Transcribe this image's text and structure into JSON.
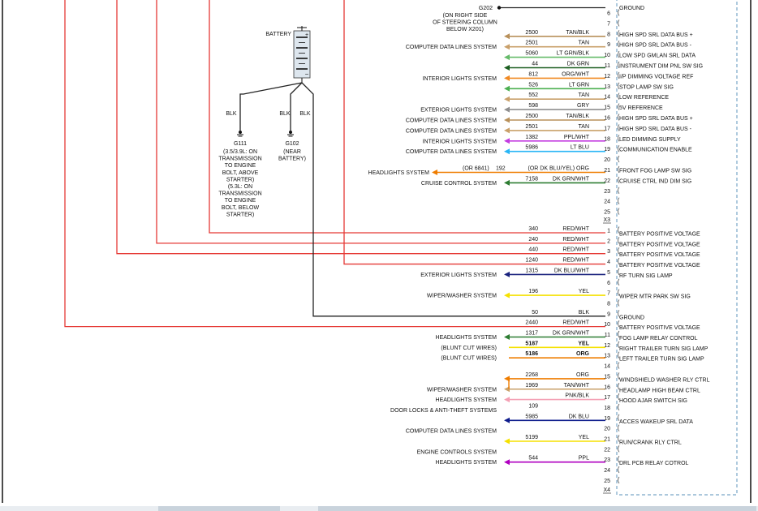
{
  "colors": {
    "RED/WHT": "#e53935",
    "TAN/BLK": "#b8905a",
    "TAN": "#c9a06a",
    "LT GRN/BLK": "#66bb6a",
    "DK GRN": "#1b5e20",
    "ORG/WHT": "#f08a24",
    "LT GRN": "#4caf50",
    "GRY": "#8e8e8e",
    "PPL/WHT": "#c33ce0",
    "LT BLU": "#29b6f6",
    "ORG": "#ef7d00",
    "DK GRN/WHT": "#2e7d32",
    "DK BLU/WHT": "#1a237e",
    "YEL": "#f5e100",
    "BLK": "#222222",
    "TAN/WHT": "#c9a06a",
    "PNK/BLK": "#f4a0b4",
    "DK BLU": "#0d1b8c",
    "PPL": "#b000c0",
    "connector": "#7aa7c7"
  },
  "top_splice": {
    "id": "G202",
    "note": [
      "(ON RIGHT SIDE",
      "OF STEERING COLUMN",
      "BELOW X201)"
    ],
    "desc": "GROUND",
    "pin": "6"
  },
  "battery": {
    "label": "BATTERY",
    "plus": "+",
    "minus": "−"
  },
  "grounds": [
    {
      "wire": "BLK",
      "id": "G111",
      "note": [
        "(3.5/3.9L: ON",
        "TRANSMISSION",
        "TO ENGINE",
        "BOLT, ABOVE",
        "STARTER)",
        "(5.3L: ON",
        "TRANSMISSION",
        "TO ENGINE",
        "BOLT, BELOW",
        "STARTER)"
      ]
    },
    {
      "wire": "BLK",
      "id": "G102",
      "note": [
        "(NEAR",
        "BATTERY)"
      ]
    },
    {
      "wire": "BLK"
    }
  ],
  "x3_label": "X3",
  "x4_label": "X4",
  "x3_rows": [
    {
      "pin": "6",
      "ckt": "",
      "color": "",
      "system": "",
      "desc": ""
    },
    {
      "pin": "7",
      "ckt": "",
      "color": "",
      "system": "",
      "desc": ""
    },
    {
      "pin": "8",
      "ckt": "2500",
      "color": "TAN/BLK",
      "system": "",
      "desc": "HIGH SPD SRL DATA BUS +"
    },
    {
      "pin": "9",
      "ckt": "2501",
      "color": "TAN",
      "system": "COMPUTER DATA LINES SYSTEM",
      "desc": "HIGH SPD SRL DATA BUS -"
    },
    {
      "pin": "10",
      "ckt": "5060",
      "color": "LT GRN/BLK",
      "system": "",
      "desc": "LOW SPD GMLAN SRL DATA"
    },
    {
      "pin": "11",
      "ckt": "44",
      "color": "DK GRN",
      "system": "",
      "desc": "INSTRUMENT DIM PNL SW SIG"
    },
    {
      "pin": "12",
      "ckt": "812",
      "color": "ORG/WHT",
      "system": "INTERIOR LIGHTS SYSTEM",
      "desc": "I/P DIMMING VOLTAGE REF"
    },
    {
      "pin": "13",
      "ckt": "526",
      "color": "LT GRN",
      "system": "",
      "desc": "STOP LAMP SW SIG"
    },
    {
      "pin": "14",
      "ckt": "552",
      "color": "TAN",
      "system": "",
      "desc": "LOW REFERENCE"
    },
    {
      "pin": "15",
      "ckt": "598",
      "color": "GRY",
      "system": "EXTERIOR LIGHTS SYSTEM",
      "desc": "5V REFERENCE"
    },
    {
      "pin": "16",
      "ckt": "2500",
      "color": "TAN/BLK",
      "system": "COMPUTER DATA LINES SYSTEM",
      "desc": "HIGH SPD SRL DATA BUS +"
    },
    {
      "pin": "17",
      "ckt": "2501",
      "color": "TAN",
      "system": "COMPUTER DATA LINES SYSTEM",
      "desc": "HIGH SPD SRL DATA BUS -"
    },
    {
      "pin": "18",
      "ckt": "1382",
      "color": "PPL/WHT",
      "system": "INTERIOR LIGHTS SYSTEM",
      "desc": "LED DIMMING SUPPLY"
    },
    {
      "pin": "19",
      "ckt": "5986",
      "color": "LT BLU",
      "system": "COMPUTER DATA LINES SYSTEM",
      "desc": "COMMUNICATION ENABLE"
    },
    {
      "pin": "20",
      "ckt": "",
      "color": "",
      "system": "",
      "desc": ""
    },
    {
      "pin": "21",
      "ckt": "192",
      "color": "(OR DK BLU/YEL) ORG",
      "alt": "(OR 6841)",
      "system": "HEADLIGHTS SYSTEM",
      "desc": "FRONT FOG LAMP SW SIG"
    },
    {
      "pin": "22",
      "ckt": "7158",
      "color": "DK GRN/WHT",
      "system": "CRUISE CONTROL SYSTEM",
      "desc": "CRUISE CTRL IND DIM SIG"
    },
    {
      "pin": "23",
      "ckt": "",
      "color": "",
      "system": "",
      "desc": ""
    },
    {
      "pin": "24",
      "ckt": "",
      "color": "",
      "system": "",
      "desc": ""
    },
    {
      "pin": "25",
      "ckt": "",
      "color": "",
      "system": "",
      "desc": ""
    }
  ],
  "x4_rows": [
    {
      "pin": "1",
      "ckt": "340",
      "color": "RED/WHT",
      "system": "",
      "desc": "BATTERY POSITIVE VOLTAGE"
    },
    {
      "pin": "2",
      "ckt": "240",
      "color": "RED/WHT",
      "system": "",
      "desc": "BATTERY POSITIVE VOLTAGE"
    },
    {
      "pin": "3",
      "ckt": "440",
      "color": "RED/WHT",
      "system": "",
      "desc": "BATTERY POSITIVE VOLTAGE"
    },
    {
      "pin": "4",
      "ckt": "1240",
      "color": "RED/WHT",
      "system": "",
      "desc": "BATTERY POSITIVE VOLTAGE"
    },
    {
      "pin": "5",
      "ckt": "1315",
      "color": "DK BLU/WHT",
      "system": "EXTERIOR LIGHTS SYSTEM",
      "desc": "RF TURN SIG LAMP"
    },
    {
      "pin": "6",
      "ckt": "",
      "color": "",
      "system": "",
      "desc": ""
    },
    {
      "pin": "7",
      "ckt": "196",
      "color": "YEL",
      "system": "WIPER/WASHER SYSTEM",
      "desc": "WIPER MTR PARK SW SIG"
    },
    {
      "pin": "8",
      "ckt": "",
      "color": "",
      "system": "",
      "desc": ""
    },
    {
      "pin": "9",
      "ckt": "50",
      "color": "BLK",
      "system": "",
      "desc": "GROUND"
    },
    {
      "pin": "10",
      "ckt": "2440",
      "color": "RED/WHT",
      "system": "",
      "desc": "BATTERY POSITIVE VOLTAGE"
    },
    {
      "pin": "11",
      "ckt": "1317",
      "color": "DK GRN/WHT",
      "system": "HEADLIGHTS SYSTEM",
      "desc": "FOG LAMP RELAY CONTROL"
    },
    {
      "pin": "12",
      "ckt": "5187",
      "color": "YEL",
      "system": "(BLUNT CUT WIRES)",
      "desc": "RIGHT TRAILER TURN SIG LAMP"
    },
    {
      "pin": "13",
      "ckt": "5186",
      "color": "ORG",
      "system": "(BLUNT CUT WIRES)",
      "desc": "LEFT TRAILER TURN SIG LAMP"
    },
    {
      "pin": "14",
      "ckt": "",
      "color": "",
      "system": "",
      "desc": ""
    },
    {
      "pin": "15",
      "ckt": "2268",
      "color": "ORG",
      "system": "",
      "desc": "WINDSHIELD WASHER RLY CTRL"
    },
    {
      "pin": "16",
      "ckt": "1969",
      "color": "TAN/WHT",
      "system": "WIPER/WASHER SYSTEM",
      "desc": "HEADLAMP HIGH BEAM CTRL"
    },
    {
      "pin": "17",
      "ckt": "",
      "color": "PNK/BLK",
      "system": "HEADLIGHTS SYSTEM",
      "desc": "HOOD AJAR SWITCH SIG"
    },
    {
      "pin": "18",
      "ckt": "109",
      "color": "",
      "system": "DOOR LOCKS & ANTI-THEFT SYSTEMS",
      "desc": ""
    },
    {
      "pin": "19",
      "ckt": "5985",
      "color": "DK BLU",
      "system": "",
      "desc": "ACCES WAKEUP SRL DATA"
    },
    {
      "pin": "20",
      "ckt": "",
      "color": "",
      "system": "COMPUTER DATA LINES SYSTEM",
      "desc": ""
    },
    {
      "pin": "21",
      "ckt": "5199",
      "color": "YEL",
      "system": "",
      "desc": "RUN/CRANK RLY CTRL"
    },
    {
      "pin": "22",
      "ckt": "",
      "color": "",
      "system": "ENGINE CONTROLS SYSTEM",
      "desc": ""
    },
    {
      "pin": "23",
      "ckt": "544",
      "color": "PPL",
      "system": "HEADLIGHTS SYSTEM",
      "desc": "DRL PCB RELAY COTROL"
    },
    {
      "pin": "24",
      "ckt": "",
      "color": "",
      "system": "",
      "desc": ""
    },
    {
      "pin": "25",
      "ckt": "",
      "color": "",
      "system": "",
      "desc": ""
    }
  ]
}
